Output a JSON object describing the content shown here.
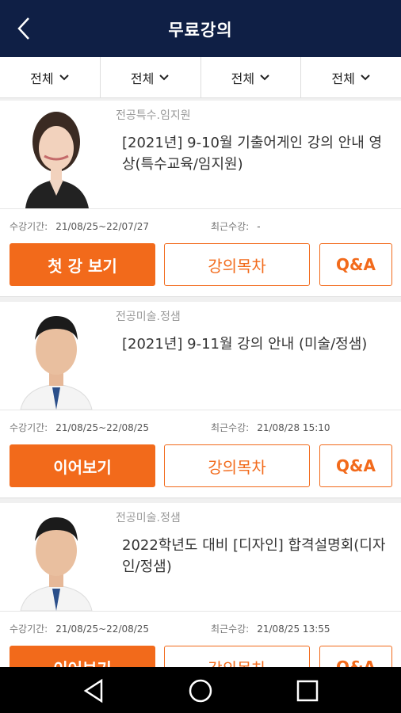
{
  "header": {
    "title": "무료강의",
    "back_icon": "chevron-left-icon"
  },
  "filters": [
    {
      "label": "전체"
    },
    {
      "label": "전체"
    },
    {
      "label": "전체"
    },
    {
      "label": "전체"
    }
  ],
  "courses": [
    {
      "category": "전공특수.임지원",
      "title": "[2021년] 9-10월 기출어게인 강의 안내 영상(특수교육/임지원)",
      "period_label": "수강기간:",
      "period": "21/08/25~22/07/27",
      "recent_label": "최근수강:",
      "recent": "-",
      "primary_label": "첫 강 보기",
      "toc_label": "강의목차",
      "qa_label": "Q&A"
    },
    {
      "category": "전공미술.정샘",
      "title": "[2021년] 9-11월 강의 안내 (미술/정샘)",
      "period_label": "수강기간:",
      "period": "21/08/25~22/08/25",
      "recent_label": "최근수강:",
      "recent": "21/08/28 15:10",
      "primary_label": "이어보기",
      "toc_label": "강의목차",
      "qa_label": "Q&A"
    },
    {
      "category": "전공미술.정샘",
      "title": "2022학년도 대비 [디자인] 합격설명회(디자인/정샘)",
      "period_label": "수강기간:",
      "period": "21/08/25~22/08/25",
      "recent_label": "최근수강:",
      "recent": "21/08/25 13:55",
      "primary_label": "이어보기",
      "toc_label": "강의목차",
      "qa_label": "Q&A"
    }
  ],
  "colors": {
    "header_bg": "#0f1f45",
    "accent": "#f26a1b"
  },
  "nav_icons": [
    "back-triangle-icon",
    "home-circle-icon",
    "recents-square-icon"
  ]
}
